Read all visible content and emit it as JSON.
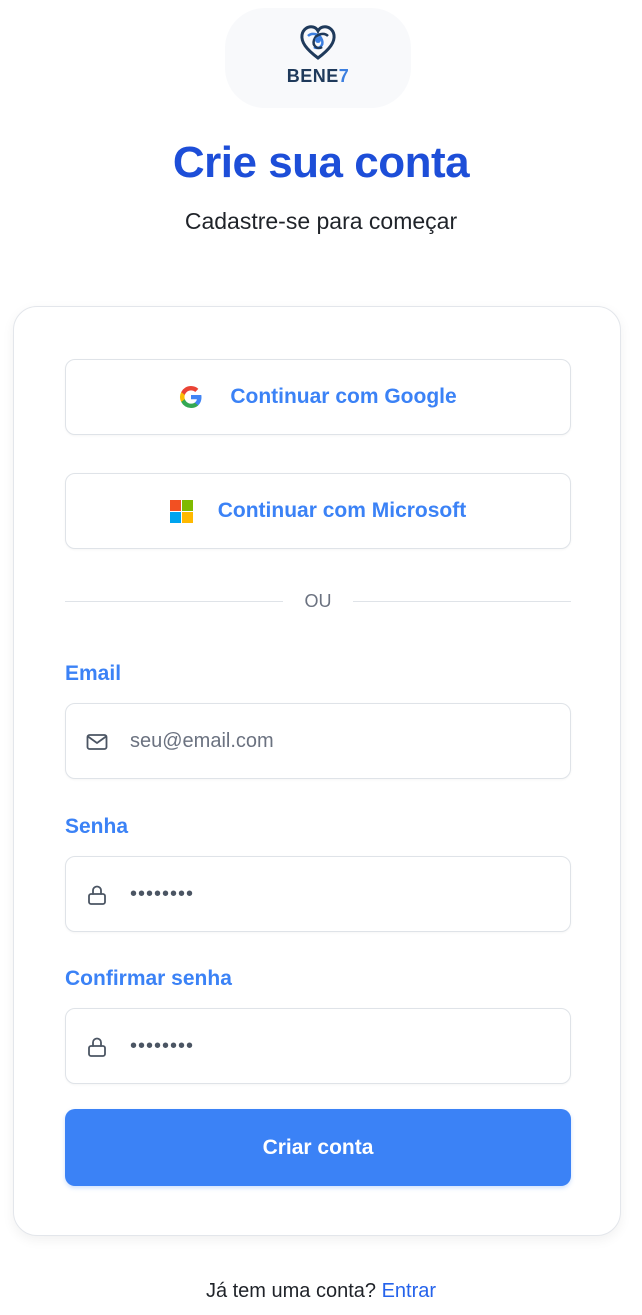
{
  "brand": {
    "logo_text_main": "BENE",
    "logo_text_suffix": "7"
  },
  "header": {
    "title": "Crie sua conta",
    "subtitle": "Cadastre-se para começar"
  },
  "oauth": {
    "google_label": "Continuar com Google",
    "microsoft_label": "Continuar com Microsoft"
  },
  "divider_text": "OU",
  "form": {
    "email": {
      "label": "Email",
      "placeholder": "seu@email.com",
      "icon": "mail-icon"
    },
    "senha": {
      "label": "Senha",
      "value": "••••••••",
      "icon": "lock-icon"
    },
    "confirmar_senha": {
      "label": "Confirmar senha",
      "value": "••••••••",
      "icon": "lock-icon"
    },
    "submit_label": "Criar conta"
  },
  "footer": {
    "prompt": "Já tem uma conta?",
    "link": "Entrar"
  },
  "colors": {
    "primary": "#3b82f6",
    "title": "#1d4ed8",
    "link": "#2563eb"
  }
}
